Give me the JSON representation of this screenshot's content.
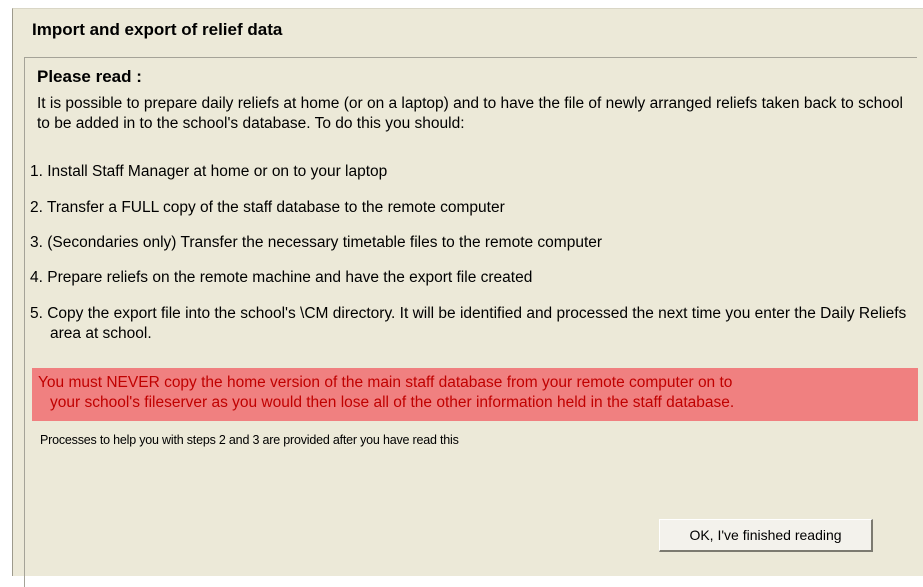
{
  "dialog": {
    "title": "Import and export of relief data",
    "heading": "Please read :",
    "intro": "It is possible to prepare daily reliefs at home (or on a laptop) and to have the file of newly arranged reliefs taken back to school to be added in to the school's database. To do this you should:",
    "steps": [
      "1.  Install Staff Manager at home or on to your laptop",
      "2.  Transfer a FULL copy of the staff database to the remote computer",
      "3.  (Secondaries only) Transfer the necessary timetable files to the remote computer",
      "4.  Prepare reliefs on the remote machine and have the export file created",
      "5. Copy the export file into the school's \\CM directory. It will be identified and processed the next time you enter the Daily Reliefs area at school."
    ],
    "warning_line1": "You must NEVER copy the home version of the main staff database from your remote computer on to",
    "warning_line2": "your school's fileserver as you would then lose all of the other information held in the staff database.",
    "note": "Processes to help you with steps 2 and 3 are provided after you have read this",
    "ok_button_label": "OK, I've finished reading",
    "colors": {
      "background": "#ece9d8",
      "warning_bg": "#f08080",
      "warning_text": "#c00000"
    }
  }
}
